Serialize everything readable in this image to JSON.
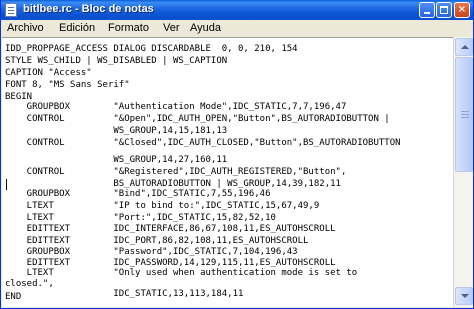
{
  "window": {
    "title": "bitlbee.rc - Bloc de notas",
    "controls": {
      "minimize": "",
      "maximize": "",
      "close": "×"
    }
  },
  "menu": [
    "Archivo",
    "Edición",
    "Formato",
    "Ver",
    "Ayuda"
  ],
  "editor": {
    "lines": [
      "IDD_PROPPAGE_ACCESS DIALOG DISCARDABLE  0, 0, 210, 154",
      "STYLE WS_CHILD | WS_DISABLED | WS_CAPTION",
      "CAPTION \"Access\"",
      "FONT 8, \"MS Sans Serif\"",
      "BEGIN",
      "    GROUPBOX        \"Authentication Mode\",IDC_STATIC,7,7,196,47",
      "    CONTROL         \"&Open\",IDC_AUTH_OPEN,\"Button\",BS_AUTORADIOBUTTON |",
      "                    WS_GROUP,14,15,181,13",
      "    CONTROL         \"&Closed\",IDC_AUTH_CLOSED,\"Button\",BS_AUTORADIOBUTTON",
      "",
      "                    WS_GROUP,14,27,160,11",
      "    CONTROL         \"&Registered\",IDC_AUTH_REGISTERED,\"Button\",",
      "                    BS_AUTORADIOBUTTON | WS_GROUP,14,39,182,11",
      "    GROUPBOX        \"Bind\",IDC_STATIC,7,55,196,46",
      "    LTEXT           \"IP to bind to:\",IDC_STATIC,15,67,49,9",
      "    LTEXT           \"Port:\",IDC_STATIC,15,82,52,10",
      "    EDITTEXT        IDC_INTERFACE,86,67,108,11,ES_AUTOHSCROLL",
      "    EDITTEXT        IDC_PORT,86,82,108,11,ES_AUTOHSCROLL",
      "    GROUPBOX        \"Password\",IDC_STATIC,7,104,196,43",
      "    EDITTEXT        IDC_PASSWORD,14,129,115,11,ES_AUTOHSCROLL",
      "    LTEXT           \"Only used when authentication mode is set to",
      "closed.\",",
      "                    IDC_STATIC,13,113,184,11",
      "",
      "END"
    ]
  }
}
